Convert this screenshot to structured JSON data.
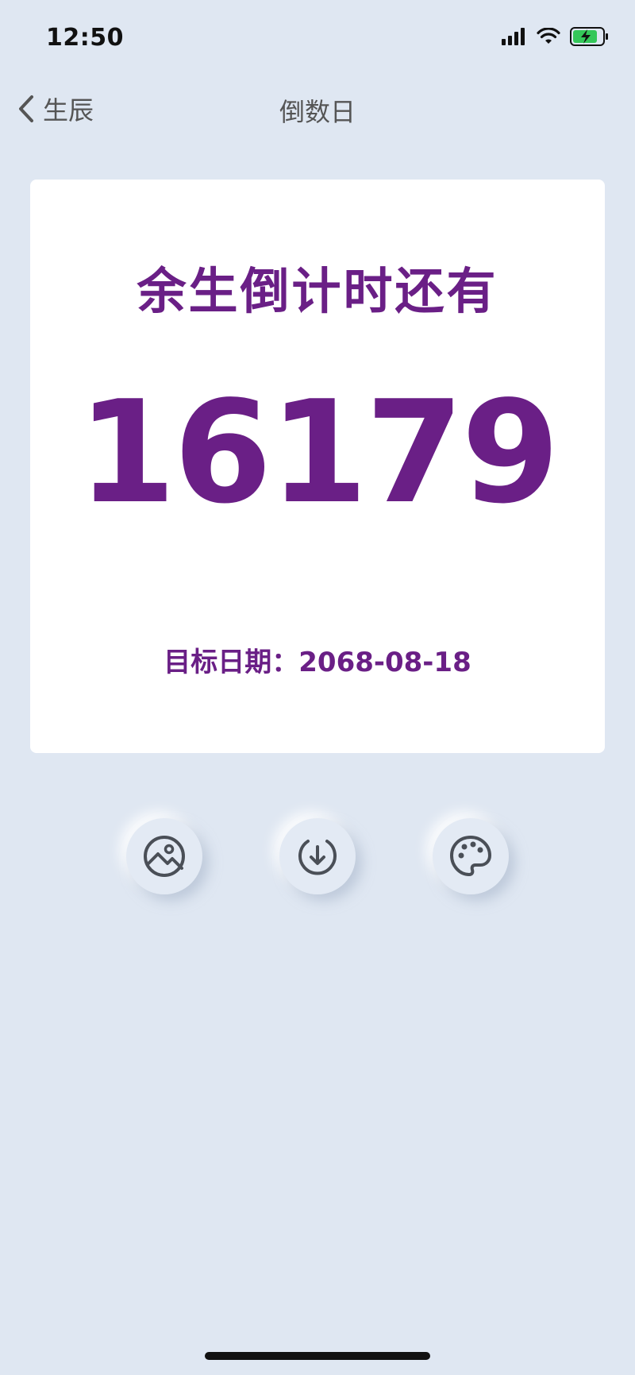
{
  "status_bar": {
    "time": "12:50"
  },
  "nav": {
    "back_label": "生辰",
    "title": "倒数日"
  },
  "card": {
    "heading": "余生倒计时还有",
    "days": "16179",
    "target_date": "目标日期：2068-08-18"
  },
  "actions": {
    "buttons": [
      {
        "icon": "image-icon"
      },
      {
        "icon": "download-icon"
      },
      {
        "icon": "palette-icon"
      }
    ]
  },
  "colors": {
    "background": "#dfe7f2",
    "card": "#ffffff",
    "accent": "#6a1f86",
    "icon": "#4a4f57"
  }
}
